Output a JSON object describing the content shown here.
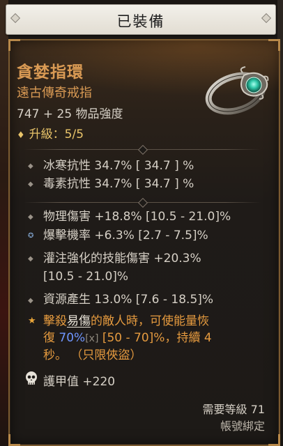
{
  "header": {
    "title": "已裝備"
  },
  "item": {
    "name": "貪婪指環",
    "type": "遠古傳奇戒指",
    "power": "747 + 25 物品強度",
    "upgrade": "升級：5/5",
    "icon": "legendary-ring-icon"
  },
  "resistances": [
    {
      "text": "冰寒抗性 34.7%  [ 34.7 ] %"
    },
    {
      "text": "毒素抗性 34.7%  [ 34.7 ] %"
    }
  ],
  "affixes": [
    {
      "text": "物理傷害 +18.8% [10.5 - 21.0]%"
    },
    {
      "text": "爆擊機率 +6.3% [2.7 - 7.5]%"
    },
    {
      "text": "灌注強化的技能傷害 +20.3%"
    },
    {
      "text": "[10.5 - 21.0]%"
    },
    {
      "text": "資源產生 13.0% [7.6 - 18.5]%"
    }
  ],
  "legendary_power": {
    "part1": "擊殺",
    "keyword": "易傷",
    "part2": "的敵人時，可使能量恢",
    "part3": "復 ",
    "value": "70%",
    "x": "[x]",
    "part4": " [50 - 70]%，持續 4",
    "part5": "秒。 （只限俠盜）"
  },
  "armor": "護甲值 +220",
  "footer": {
    "required_level": "需要等級 71",
    "account_bound": "帳號綁定"
  },
  "colors": {
    "legendary": "#d99a54",
    "power_text": "#e59a3f",
    "value_blue": "#6f95ff"
  }
}
